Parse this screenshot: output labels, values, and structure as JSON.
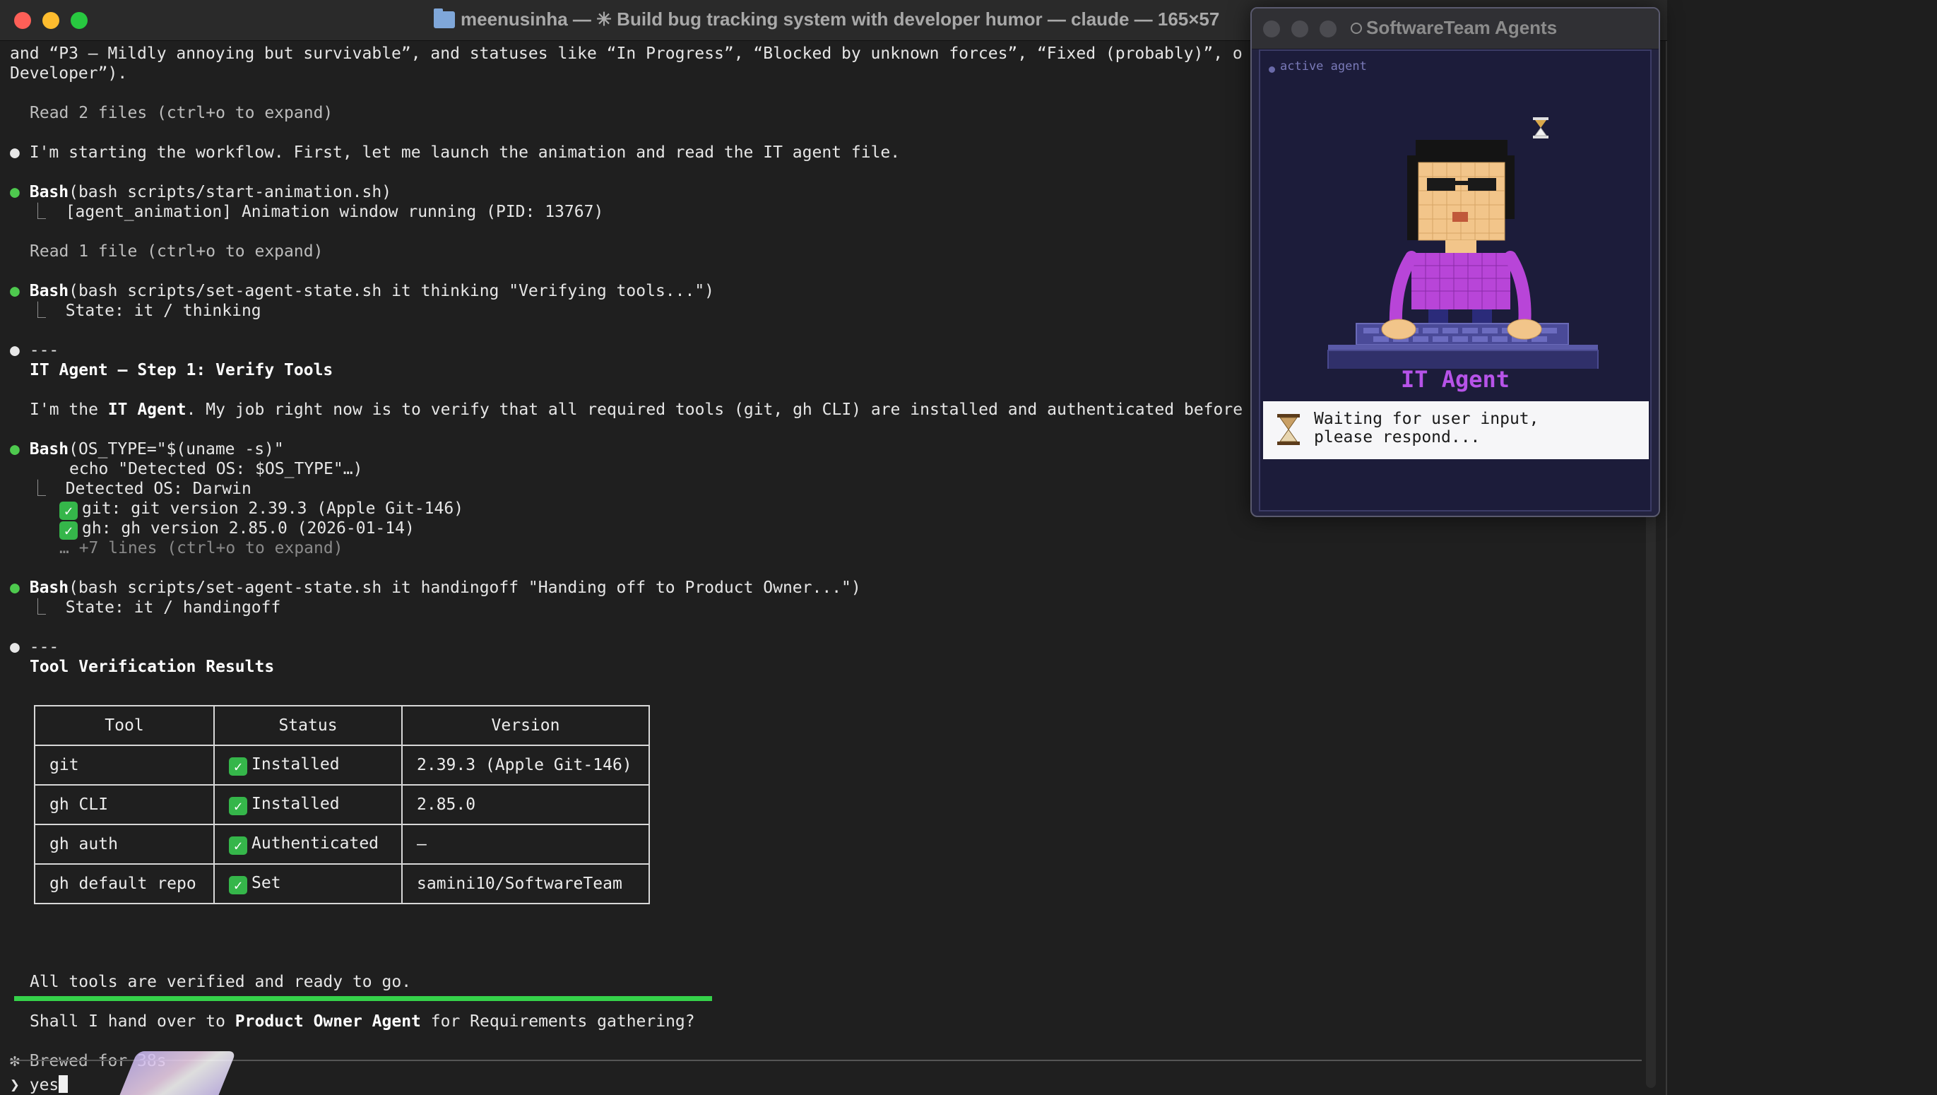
{
  "terminal": {
    "title": "meenusinha — ✳ Build bug tracking system with developer humor — claude — 165×57",
    "line_intro_1": "and “P3 — Mildly annoying but survivable”, and statuses like “In Progress”, “Blocked by unknown forces”, “Fixed (probably)”, o",
    "line_intro_2": "Developer”).",
    "read_2_files": "Read 2 files (ctrl+o to expand)",
    "starting": "I'm starting the workflow. First, let me launch the animation and read the IT agent file.",
    "bash1_tool": "Bash",
    "bash1_cmd": "(bash scripts/start-animation.sh)",
    "bash1_out": "[agent_animation] Animation window running (PID: 13767)",
    "read_1_file": "Read 1 file (ctrl+o to expand)",
    "bash2_tool": "Bash",
    "bash2_cmd": "(bash scripts/set-agent-state.sh it thinking \"Verifying tools...\")",
    "bash2_out": "State: it / thinking",
    "sep1": "---",
    "step_heading": "IT Agent — Step 1: Verify Tools",
    "job_pre": "I'm the ",
    "job_bold": "IT Agent",
    "job_post": ". My job right now is to verify that all required tools (git, gh CLI) are installed and authenticated before",
    "bash3_tool": "Bash",
    "bash3_cmd": "(OS_TYPE=\"$(uname -s)\"",
    "bash3_cmd2": "echo \"Detected OS: $OS_TYPE\"…)",
    "bash3_out1": "Detected OS: Darwin",
    "bash3_out2": "git: git version 2.39.3 (Apple Git-146)",
    "bash3_out3": "gh: gh version 2.85.0 (2026-01-14)",
    "bash3_more": "… +7 lines (ctrl+o to expand)",
    "bash4_tool": "Bash",
    "bash4_cmd": "(bash scripts/set-agent-state.sh it handingoff \"Handing off to Product Owner...\")",
    "bash4_out": "State: it / handingoff",
    "sep2": "---",
    "results_heading": "Tool Verification Results",
    "table": {
      "headers": [
        "Tool",
        "Status",
        "Version"
      ],
      "rows": [
        {
          "tool": "git",
          "status": "Installed",
          "version": "2.39.3 (Apple Git-146)"
        },
        {
          "tool": "gh CLI",
          "status": "Installed",
          "version": "2.85.0"
        },
        {
          "tool": "gh auth",
          "status": "Authenticated",
          "version": "—"
        },
        {
          "tool": "gh default repo",
          "status": "Set",
          "version": "samini10/SoftwareTeam"
        }
      ]
    },
    "all_verified": "All tools are verified and ready to go.",
    "question_pre": "Shall I hand over to ",
    "question_bold": "Product Owner Agent",
    "question_post": " for Requirements gathering?",
    "brewed": "✻ Brewed for 38s",
    "prompt_symbol": "❯",
    "prompt_value": "yes"
  },
  "agents_window": {
    "title": "SoftwareTeam Agents",
    "active_label": "active agent",
    "agent_name": "IT Agent",
    "status_icon": "hourglass-icon",
    "status_text": "Waiting for user input,\nplease respond...",
    "colors": {
      "accent": "#b653e8",
      "panel": "#1c1c3a"
    }
  },
  "colors": {
    "bullet_green": "#4ec94e",
    "progress": "#35d14a",
    "check": "#35b64a"
  }
}
